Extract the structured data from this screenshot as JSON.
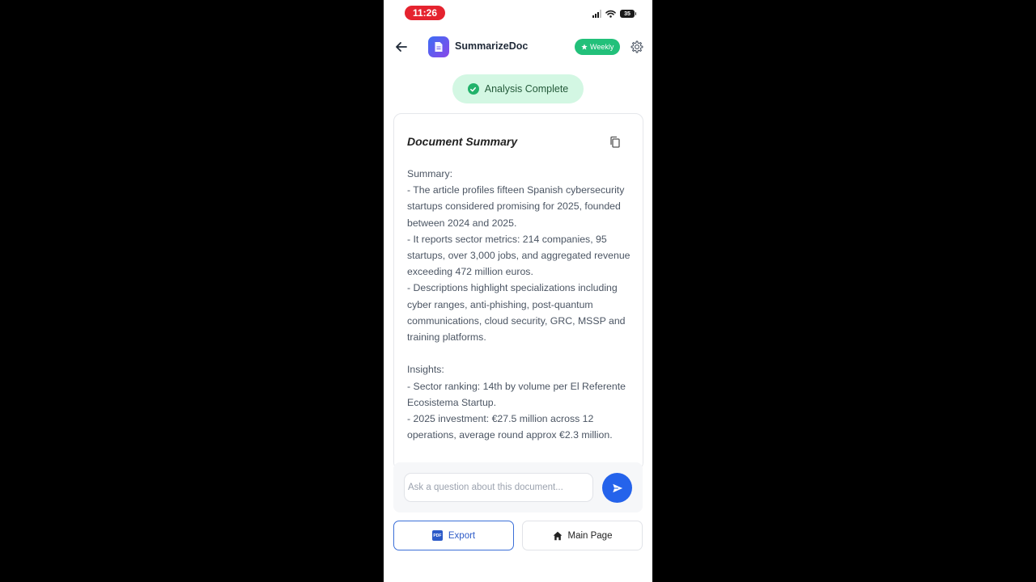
{
  "status_bar": {
    "time": "11:26",
    "battery": "35"
  },
  "header": {
    "back_icon": "arrow-left-icon",
    "app_logo_icon": "document-icon",
    "app_title": "SummarizeDoc",
    "badge_icon": "star-icon",
    "badge_label": "Weekly",
    "settings_icon": "gear-icon"
  },
  "status_pill": {
    "icon": "check-circle-icon",
    "label": "Analysis Complete"
  },
  "summary_card": {
    "title": "Document Summary",
    "copy_icon": "copy-icon",
    "text": "Summary:\n- The article profiles fifteen Spanish cybersecurity startups considered promising for 2025, founded between 2024 and 2025.\n- It reports sector metrics: 214 companies, 95 startups, over 3,000 jobs, and aggregated revenue exceeding 472 million euros.\n- Descriptions highlight specializations including cyber ranges, anti-phishing, post-quantum communications, cloud security, GRC, MSSP and training platforms.\n\nInsights:\n- Sector ranking: 14th by volume per El Referente Ecosistema Startup.\n- 2025 investment: €27.5 million across 12 operations, average round approx €2.3 million."
  },
  "ask": {
    "placeholder": "Ask a question about this document...",
    "value": "",
    "send_icon": "send-icon"
  },
  "actions": {
    "export_label": "Export",
    "export_icon": "pdf-icon",
    "export_icon_text": "PDF",
    "main_label": "Main Page",
    "main_icon": "home-icon"
  },
  "colors": {
    "status_time_bg": "#e5232f",
    "badge_green": "#22c07a",
    "pill_bg": "#d3f7e3",
    "check_green": "#22b26b",
    "send_blue": "#2563eb",
    "export_blue": "#3b6fd8"
  }
}
